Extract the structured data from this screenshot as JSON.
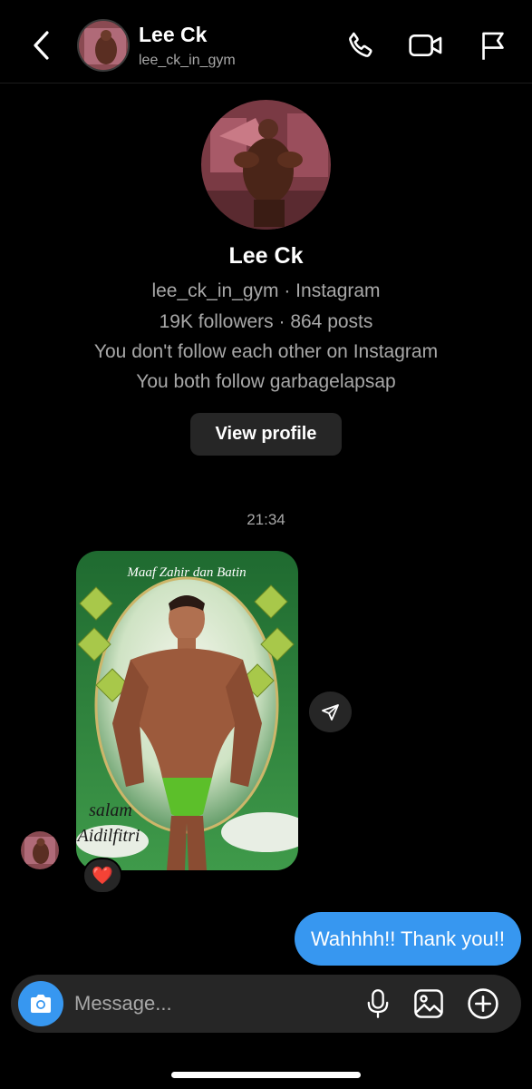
{
  "header": {
    "name": "Lee Ck",
    "handle": "lee_ck_in_gym",
    "icons": [
      "back-arrow-icon",
      "phone-icon",
      "video-camera-icon",
      "flag-icon"
    ]
  },
  "profile": {
    "name": "Lee Ck",
    "line1": "lee_ck_in_gym · Instagram",
    "line2": "19K followers · 864 posts",
    "line3": "You don't follow each other on Instagram",
    "line4": "You both follow garbagelapsap",
    "view_profile_label": "View profile"
  },
  "thread": {
    "timestamp": "21:34",
    "image_message": {
      "caption_top": "Maaf Zahir dan Batin",
      "caption_bottom_1": "salam",
      "caption_bottom_2": "Aidilfitri",
      "reaction": "❤️"
    },
    "sent_message": "Wahhhh!! Thank you!!"
  },
  "composer": {
    "placeholder": "Message...",
    "icons": [
      "camera-icon",
      "microphone-icon",
      "gallery-icon",
      "plus-icon"
    ]
  },
  "colors": {
    "background": "#000000",
    "accent": "#3797f0",
    "surface": "#262626",
    "secondary_text": "#a8a8a8"
  }
}
